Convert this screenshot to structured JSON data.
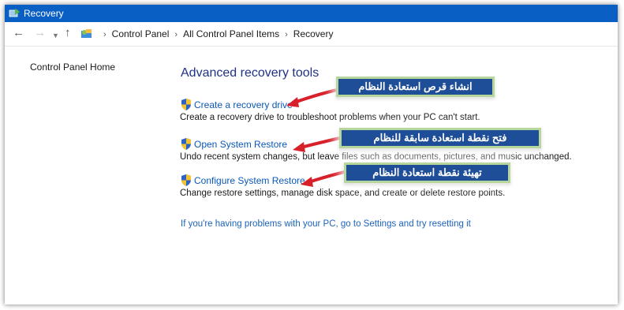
{
  "window": {
    "title": "Recovery"
  },
  "address": {
    "crumbs": [
      "Control Panel",
      "All Control Panel Items",
      "Recovery"
    ]
  },
  "sidebar": {
    "home_label": "Control Panel Home"
  },
  "main": {
    "heading": "Advanced recovery tools",
    "tools": [
      {
        "link": "Create a recovery drive",
        "description": "Create a recovery drive to troubleshoot problems when your PC can't start."
      },
      {
        "link": "Open System Restore",
        "description": "Undo recent system changes, but leave files such as documents, pictures, and music unchanged."
      },
      {
        "link": "Configure System Restore",
        "description": "Change restore settings, manage disk space, and create or delete restore points."
      }
    ],
    "reset_link": "If you're having problems with your PC, go to Settings and try resetting it"
  },
  "annotations": [
    "انشاء قرص استعادة النظام",
    "فتح نقطة استعادة سابقة للنظام",
    "تهيئة نقطة استعادة النظام"
  ],
  "colors": {
    "titlebar": "#0a5fc5",
    "link": "#0b58b8",
    "heading": "#1e3287",
    "callout_bg": "#1f4e98",
    "callout_border": "#b7d69c",
    "arrow": "#d8202a"
  },
  "icons": {
    "app": "recovery-icon",
    "back": "back-arrow-icon",
    "forward": "forward-arrow-icon",
    "recent": "chevron-down-icon",
    "up": "up-arrow-icon",
    "location": "control-panel-icon",
    "tool": "uac-shield-icon"
  }
}
